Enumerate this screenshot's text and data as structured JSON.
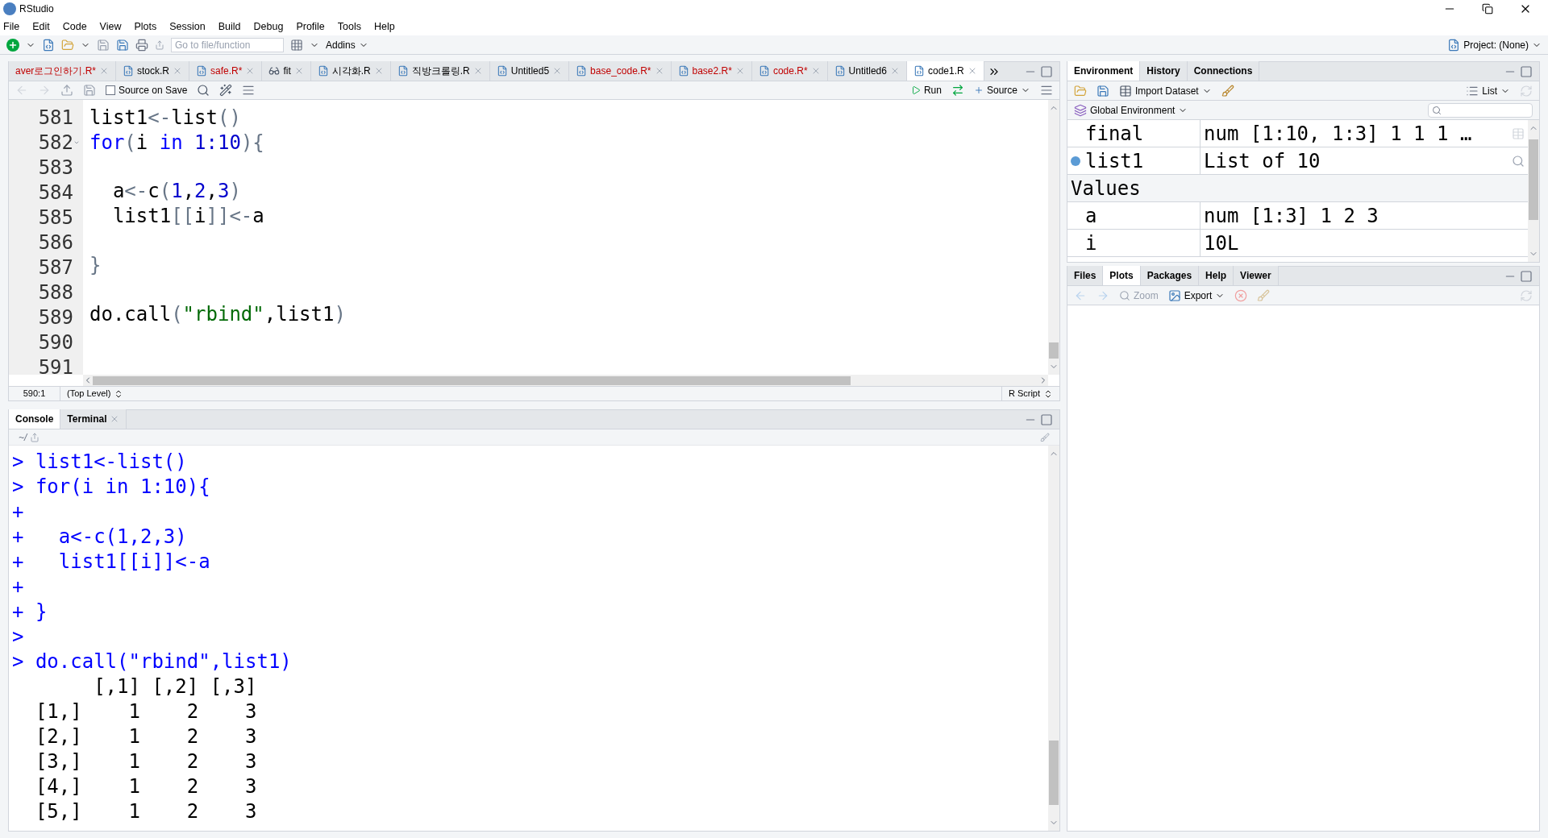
{
  "window": {
    "title": "RStudio"
  },
  "menu": [
    "File",
    "Edit",
    "Code",
    "View",
    "Plots",
    "Session",
    "Build",
    "Debug",
    "Profile",
    "Tools",
    "Help"
  ],
  "toolbar": {
    "goto_placeholder": "Go to file/function",
    "addins": "Addins",
    "project": "Project: (None)"
  },
  "editor": {
    "tabs": [
      {
        "label": "aver로그인하기.R*",
        "kind": "partial",
        "modified": true,
        "selected": false
      },
      {
        "label": "stock.R",
        "kind": "script",
        "modified": false,
        "selected": false
      },
      {
        "label": "safe.R*",
        "kind": "script",
        "modified": true,
        "selected": false
      },
      {
        "label": "fit",
        "kind": "viewer",
        "modified": false,
        "selected": false
      },
      {
        "label": "시각화.R",
        "kind": "script",
        "modified": false,
        "selected": false
      },
      {
        "label": "직방크롤링.R",
        "kind": "script",
        "modified": false,
        "selected": false
      },
      {
        "label": "Untitled5",
        "kind": "script",
        "modified": false,
        "selected": false
      },
      {
        "label": "base_code.R*",
        "kind": "script",
        "modified": true,
        "selected": false
      },
      {
        "label": "base2.R*",
        "kind": "script",
        "modified": true,
        "selected": false
      },
      {
        "label": "code.R*",
        "kind": "script",
        "modified": true,
        "selected": false
      },
      {
        "label": "Untitled6",
        "kind": "script",
        "modified": false,
        "selected": false
      },
      {
        "label": "code1.R",
        "kind": "script",
        "modified": false,
        "selected": true
      }
    ],
    "source_on_save": {
      "label": "Source on Save",
      "checked": false
    },
    "run": "Run",
    "source": "Source",
    "lines": [
      {
        "number": "581",
        "tokens": [
          {
            "text": "list1",
            "kind": "plain"
          },
          {
            "text": "<-",
            "kind": "punct"
          },
          {
            "text": "list",
            "kind": "plain"
          },
          {
            "text": "()",
            "kind": "punct"
          }
        ]
      },
      {
        "number": "582",
        "fold": true,
        "tokens": [
          {
            "text": "for",
            "kind": "keyword"
          },
          {
            "text": "(",
            "kind": "punct"
          },
          {
            "text": "i ",
            "kind": "plain"
          },
          {
            "text": "in",
            "kind": "keyword"
          },
          {
            "text": " 1:10",
            "kind": "number"
          },
          {
            "text": "){",
            "kind": "punct"
          }
        ]
      },
      {
        "number": "583"
      },
      {
        "number": "584",
        "tokens": [
          {
            "text": "  a",
            "kind": "plain"
          },
          {
            "text": "<-",
            "kind": "punct"
          },
          {
            "text": "c",
            "kind": "plain"
          },
          {
            "text": "(",
            "kind": "punct"
          },
          {
            "text": "1",
            "kind": "number"
          },
          {
            "text": ",",
            "kind": "plain"
          },
          {
            "text": "2",
            "kind": "number"
          },
          {
            "text": ",",
            "kind": "plain"
          },
          {
            "text": "3",
            "kind": "number"
          },
          {
            "text": ")",
            "kind": "punct"
          }
        ]
      },
      {
        "number": "585",
        "tokens": [
          {
            "text": "  list1",
            "kind": "plain"
          },
          {
            "text": "[[",
            "kind": "punct"
          },
          {
            "text": "i",
            "kind": "plain"
          },
          {
            "text": "]]<-",
            "kind": "punct"
          },
          {
            "text": "a",
            "kind": "plain"
          }
        ]
      },
      {
        "number": "586"
      },
      {
        "number": "587",
        "tokens": [
          {
            "text": "}",
            "kind": "punct"
          }
        ]
      },
      {
        "number": "588"
      },
      {
        "number": "589",
        "tokens": [
          {
            "text": "do.call",
            "kind": "plain"
          },
          {
            "text": "(",
            "kind": "punct"
          },
          {
            "text": "\"rbind\"",
            "kind": "string"
          },
          {
            "text": ",list1",
            "kind": "plain"
          },
          {
            "text": ")",
            "kind": "punct"
          }
        ]
      },
      {
        "number": "590"
      },
      {
        "number": "591"
      }
    ],
    "status": {
      "position": "590:1",
      "scope": "(Top Level)",
      "file_type": "R Script"
    }
  },
  "console": {
    "tabs": [
      {
        "label": "Console",
        "closable": false,
        "selected": true
      },
      {
        "label": "Terminal",
        "closable": true,
        "selected": false
      }
    ],
    "path": "~/",
    "lines": [
      {
        "kind": "input",
        "prompt": ">",
        "text": "list1<-list()"
      },
      {
        "kind": "input",
        "prompt": ">",
        "text": "for(i in 1:10){"
      },
      {
        "kind": "input",
        "prompt": "+"
      },
      {
        "kind": "input",
        "prompt": "+",
        "text": "  a<-c(1,2,3)"
      },
      {
        "kind": "input",
        "prompt": "+",
        "text": "  list1[[i]]<-a"
      },
      {
        "kind": "input",
        "prompt": "+"
      },
      {
        "kind": "input",
        "prompt": "+",
        "text": "}"
      },
      {
        "kind": "input",
        "prompt": ">"
      },
      {
        "kind": "input",
        "prompt": ">",
        "text": "do.call(\"rbind\",list1)"
      },
      {
        "kind": "output",
        "text": "     [,1] [,2] [,3]"
      },
      {
        "kind": "output",
        "text": "[1,]    1    2    3"
      },
      {
        "kind": "output",
        "text": "[2,]    1    2    3"
      },
      {
        "kind": "output",
        "text": "[3,]    1    2    3"
      },
      {
        "kind": "output",
        "text": "[4,]    1    2    3"
      },
      {
        "kind": "output",
        "text": "[5,]    1    2    3"
      }
    ]
  },
  "environment": {
    "tabs": [
      {
        "label": "Environment",
        "selected": true
      },
      {
        "label": "History",
        "selected": false
      },
      {
        "label": "Connections",
        "selected": false
      }
    ],
    "import_dataset": "Import Dataset",
    "view_mode": "List",
    "scope": "Global Environment",
    "rows": [
      {
        "kind": "data",
        "name": "final",
        "value": "num [1:10, 1:3] 1 1 1 …"
      },
      {
        "kind": "list",
        "name": "list1",
        "value": "List of 10"
      },
      {
        "kind": "section",
        "name": "Values"
      },
      {
        "kind": "value",
        "name": "a",
        "value": "num [1:3] 1 2 3"
      },
      {
        "kind": "value",
        "name": "i",
        "value": "10L"
      }
    ]
  },
  "files": {
    "tabs": [
      {
        "label": "Files",
        "selected": false
      },
      {
        "label": "Plots",
        "selected": true
      },
      {
        "label": "Packages",
        "selected": false
      },
      {
        "label": "Help",
        "selected": false
      },
      {
        "label": "Viewer",
        "selected": false
      }
    ],
    "zoom": "Zoom",
    "export": "Export"
  }
}
